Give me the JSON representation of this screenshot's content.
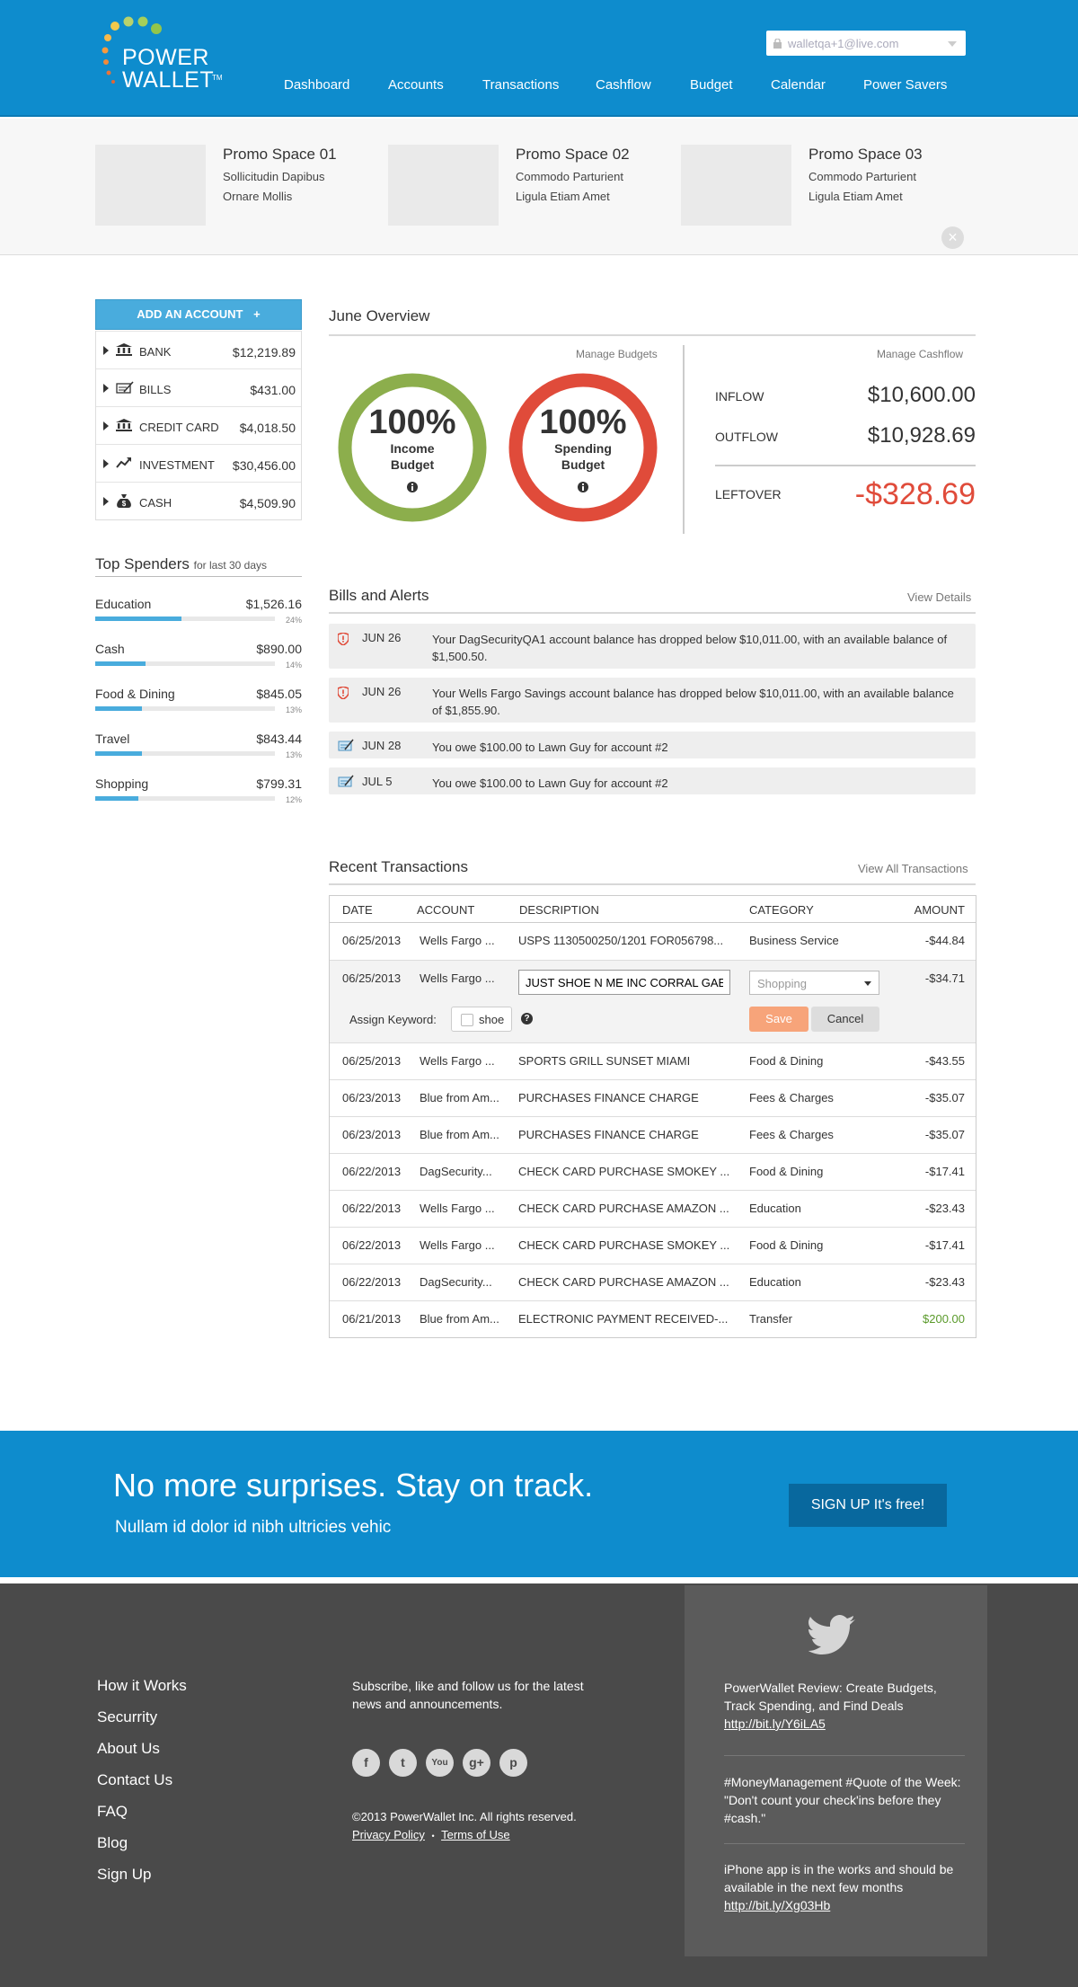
{
  "header": {
    "logo_line1": "POWER",
    "logo_line2": "WALLET",
    "logo_tm": "TM",
    "user_email": "walletqa+1@live.com",
    "nav": [
      "Dashboard",
      "Accounts",
      "Transactions",
      "Cashflow",
      "Budget",
      "Calendar",
      "Power Savers"
    ]
  },
  "promos": [
    {
      "title": "Promo Space 01",
      "line1": "Sollicitudin Dapibus",
      "line2": "Ornare Mollis"
    },
    {
      "title": "Promo Space 02",
      "line1": "Commodo Parturient",
      "line2": "Ligula Etiam Amet"
    },
    {
      "title": "Promo Space 03",
      "line1": "Commodo Parturient",
      "line2": "Ligula Etiam Amet"
    }
  ],
  "promo_close": "×",
  "sidebar": {
    "add_account": "ADD AN ACCOUNT",
    "add_plus": "+",
    "accounts": [
      {
        "name": "BANK",
        "amount": "$12,219.89",
        "icon": "bank-icon"
      },
      {
        "name": "BILLS",
        "amount": "$431.00",
        "icon": "bills-icon"
      },
      {
        "name": "CREDIT CARD",
        "amount": "$4,018.50",
        "icon": "bank-icon"
      },
      {
        "name": "INVESTMENT",
        "amount": "$30,456.00",
        "icon": "trend-icon"
      },
      {
        "name": "CASH",
        "amount": "$4,509.90",
        "icon": "moneybag-icon"
      }
    ],
    "top_spenders_title": "Top Spenders",
    "top_spenders_sub": "for last 30 days",
    "spenders": [
      {
        "name": "Education",
        "amount": "$1,526.16",
        "pct_label": "24%",
        "pct": 24
      },
      {
        "name": "Cash",
        "amount": "$890.00",
        "pct_label": "14%",
        "pct": 14
      },
      {
        "name": "Food & Dining",
        "amount": "$845.05",
        "pct_label": "13%",
        "pct": 13
      },
      {
        "name": "Travel",
        "amount": "$843.44",
        "pct_label": "13%",
        "pct": 13
      },
      {
        "name": "Shopping",
        "amount": "$799.31",
        "pct_label": "12%",
        "pct": 12
      }
    ]
  },
  "overview": {
    "title": "June Overview",
    "manage_budgets": "Manage Budgets",
    "manage_cashflow": "Manage Cashflow",
    "income_pct": "100%",
    "income_label1": "Income",
    "income_label2": "Budget",
    "spending_pct": "100%",
    "spending_label1": "Spending",
    "spending_label2": "Budget",
    "inflow_label": "INFLOW",
    "inflow": "$10,600.00",
    "outflow_label": "OUTFLOW",
    "outflow": "$10,928.69",
    "leftover_label": "LEFTOVER",
    "leftover": "-$328.69",
    "colors": {
      "income": "#8cae4c",
      "spending": "#e04b3a",
      "negative": "#e04b3a"
    }
  },
  "alerts": {
    "title": "Bills and Alerts",
    "view_details": "View Details",
    "items": [
      {
        "date": "JUN 26",
        "message": "Your DagSecurityQA1 account balance has dropped below $10,011.00, with an available balance of $1,500.50.",
        "icon": "shield-alert-icon"
      },
      {
        "date": "JUN 26",
        "message": "Your Wells Fargo Savings account balance has dropped below $10,011.00, with an available balance of $1,855.90.",
        "icon": "shield-alert-icon"
      },
      {
        "date": "JUN 28",
        "message": "You owe $100.00 to Lawn Guy for account #2",
        "icon": "bill-icon"
      },
      {
        "date": "JUL 5",
        "message": "You owe $100.00 to Lawn Guy for account #2",
        "icon": "bill-icon"
      }
    ]
  },
  "transactions": {
    "title": "Recent Transactions",
    "view_all": "View All Transactions",
    "columns": [
      "DATE",
      "ACCOUNT",
      "DESCRIPTION",
      "CATEGORY",
      "AMOUNT"
    ],
    "first": {
      "date": "06/25/2013",
      "account": "Wells Fargo ...",
      "description": "USPS 1130500250/1201 FOR056798...",
      "category": "Business Service",
      "amount": "-$44.84"
    },
    "editing": {
      "date": "06/25/2013",
      "account": "Wells Fargo ...",
      "description_value": "JUST SHOE N ME INC CORRAL GAE",
      "category_placeholder": "Shopping",
      "amount": "-$34.71",
      "assign_keyword_label": "Assign Keyword:",
      "keyword": "shoe",
      "help": "?",
      "save": "Save",
      "cancel": "Cancel"
    },
    "rows": [
      {
        "date": "06/25/2013",
        "account": "Wells Fargo ...",
        "description": "SPORTS GRILL SUNSET MIAMI",
        "category": "Food & Dining",
        "amount": "-$43.55"
      },
      {
        "date": "06/23/2013",
        "account": "Blue from Am...",
        "description": "PURCHASES FINANCE CHARGE",
        "category": "Fees & Charges",
        "amount": "-$35.07"
      },
      {
        "date": "06/23/2013",
        "account": "Blue from Am...",
        "description": "PURCHASES FINANCE CHARGE",
        "category": "Fees & Charges",
        "amount": "-$35.07"
      },
      {
        "date": "06/22/2013",
        "account": "DagSecurity...",
        "description": "CHECK CARD PURCHASE SMOKEY ...",
        "category": "Food & Dining",
        "amount": "-$17.41"
      },
      {
        "date": "06/22/2013",
        "account": "Wells Fargo ...",
        "description": "CHECK CARD PURCHASE AMAZON ...",
        "category": "Education",
        "amount": "-$23.43"
      },
      {
        "date": "06/22/2013",
        "account": "Wells Fargo ...",
        "description": "CHECK CARD PURCHASE SMOKEY ...",
        "category": "Food & Dining",
        "amount": "-$17.41"
      },
      {
        "date": "06/22/2013",
        "account": "DagSecurity...",
        "description": "CHECK CARD PURCHASE AMAZON ...",
        "category": "Education",
        "amount": "-$23.43"
      },
      {
        "date": "06/21/2013",
        "account": "Blue from Am...",
        "description": "ELECTRONIC PAYMENT RECEIVED-...",
        "category": "Transfer",
        "amount": "$200.00",
        "positive": true
      }
    ],
    "positive_color": "#5a9a2a"
  },
  "cta": {
    "headline": "No more surprises. Stay on track.",
    "sub": "Nullam id dolor id nibh ultricies vehic",
    "button": "SIGN UP",
    "button_em": "It's free!"
  },
  "footer": {
    "links": [
      "How it Works",
      "Securrity",
      "About Us",
      "Contact Us",
      "FAQ",
      "Blog",
      "Sign Up"
    ],
    "subscribe": "Subscribe, like and follow us for the latest news and announcements.",
    "social": [
      {
        "label": "f",
        "icon": "facebook-icon"
      },
      {
        "label": "t",
        "icon": "twitter-icon"
      },
      {
        "label": "You",
        "icon": "youtube-icon"
      },
      {
        "label": "g+",
        "icon": "googleplus-icon"
      },
      {
        "label": "p",
        "icon": "pinterest-icon"
      }
    ],
    "copyright": "©2013 PowerWallet Inc. All rights reserved.",
    "privacy": "Privacy Policy",
    "sep": "•",
    "terms": "Terms of Use",
    "tweets": [
      {
        "text": "PowerWallet Review: Create Budgets, Track Spending, and Find Deals",
        "link": "http://bit.ly/Y6iLA5"
      },
      {
        "text": "#MoneyManagement #Quote of the Week: \"Don't count your check'ins before they #cash.\"",
        "link": ""
      },
      {
        "text": "iPhone app is in the works and should be available in the next few months",
        "link": "http://bit.ly/Xg03Hb"
      }
    ]
  }
}
